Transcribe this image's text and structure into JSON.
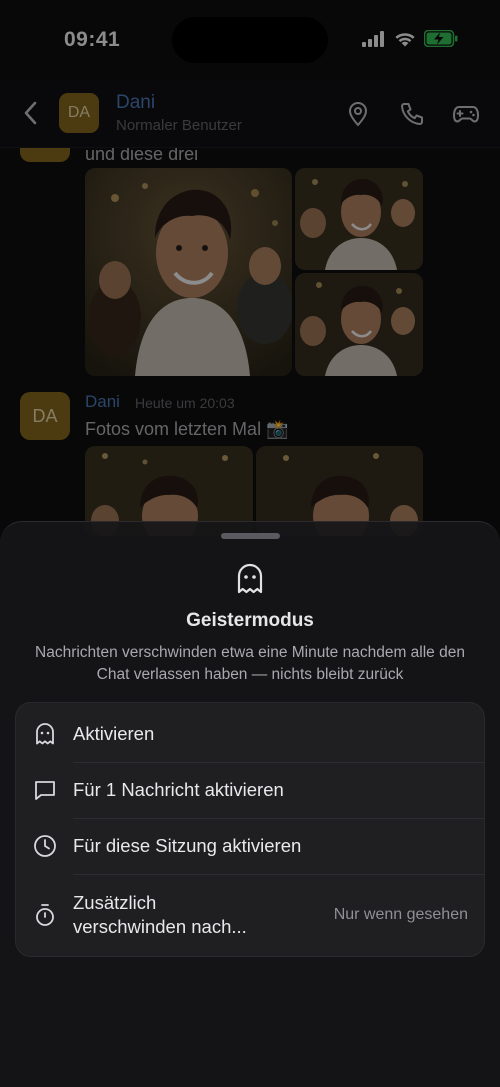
{
  "status_bar": {
    "time": "09:41"
  },
  "header": {
    "avatar_initials": "DA",
    "name": "Dani",
    "subtitle": "Normaler Benutzer"
  },
  "messages": {
    "first_text": "und diese drei",
    "second": {
      "avatar_initials": "DA",
      "author": "Dani",
      "time": "Heute um 20:03",
      "text": "Fotos vom letzten Mal 📸"
    }
  },
  "sheet": {
    "icon": "ghost-icon",
    "title": "Geistermodus",
    "description": "Nachrichten verschwinden etwa eine Minute nachdem alle den Chat verlassen haben — nichts bleibt zurück",
    "options": [
      {
        "icon": "ghost-icon",
        "label": "Aktivieren"
      },
      {
        "icon": "message-bubble-icon",
        "label": "Für 1 Nachricht aktivieren"
      },
      {
        "icon": "clock-icon",
        "label": "Für diese Sitzung aktivieren"
      },
      {
        "icon": "timer-icon",
        "label_line1": "Zusätzlich",
        "label_line2": "verschwinden nach...",
        "value": "Nur wenn gesehen"
      }
    ]
  },
  "colors": {
    "accent_name": "#4f7fc0",
    "avatar_bg": "#8b6a1e",
    "battery": "#37c759"
  }
}
